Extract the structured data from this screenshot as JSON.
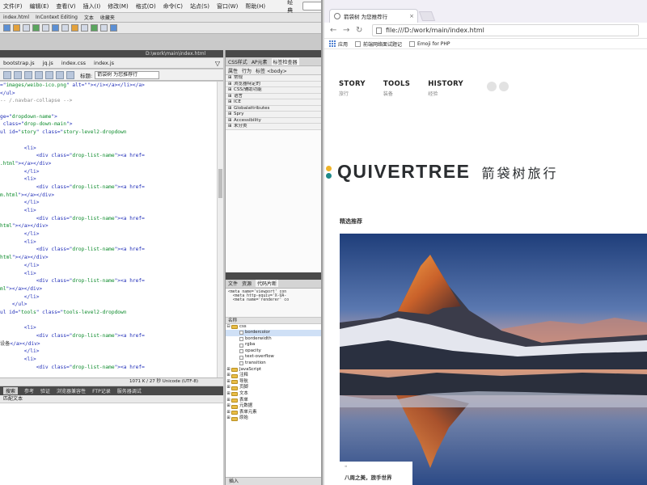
{
  "ide": {
    "menu": [
      "文件(F)",
      "编辑(E)",
      "查看(V)",
      "插入(I)",
      "修改(M)",
      "格式(O)",
      "命令(C)",
      "站点(S)",
      "窗口(W)",
      "帮助(H)"
    ],
    "search_mode": "经典",
    "window_buttons": [
      "–",
      "□",
      "✕"
    ],
    "doc_tabs": [
      "index.html",
      "InContext Editing",
      "文本",
      "收藏夹"
    ],
    "path": "D:\\work\\main\\index.html",
    "file_tabs": [
      "bootstrap.js",
      "jq.js",
      "index.css",
      "index.js"
    ],
    "filter_icon": "funnel-icon",
    "title_label": "标题:",
    "title_value": "箭袋树 为您推荐行",
    "code_lines": [
      [
        [
          "attr",
          "=\""
        ],
        [
          "str",
          "images/weibo-ico.png"
        ],
        [
          "attr",
          "\" alt=\"\">"
        ],
        [
          "tag",
          "</i></a></li></a>"
        ]
      ],
      [
        [
          "tag",
          "</ul>"
        ]
      ],
      [
        [
          "cmt",
          "-- /.navbar-collapse -->"
        ]
      ],
      [
        [
          "txt",
          ""
        ]
      ],
      [
        [
          "attr",
          "ge=\""
        ],
        [
          "str",
          "dropdown-name"
        ],
        [
          "attr",
          "\">"
        ]
      ],
      [
        [
          "tag",
          " class=\""
        ],
        [
          "str",
          "drop-down-main"
        ],
        [
          "tag",
          "\">"
        ]
      ],
      [
        [
          "tag",
          "ul id=\""
        ],
        [
          "str",
          "story"
        ],
        [
          "tag",
          "\" class=\""
        ],
        [
          "str",
          "story-level2-dropdown"
        ]
      ],
      [
        [
          "txt",
          ""
        ]
      ],
      [
        [
          "tag",
          "        <li>"
        ]
      ],
      [
        [
          "tag",
          "            <div class=\""
        ],
        [
          "str",
          "drop-list-name"
        ],
        [
          "tag",
          "\"><a href="
        ]
      ],
      [
        [
          "str",
          ".html"
        ],
        [
          "tag",
          "\">"
        ],
        [
          "txt",
          "\u0007"
        ],
        [
          "tag",
          "</a></div>"
        ]
      ],
      [
        [
          "tag",
          "        </li>"
        ]
      ],
      [
        [
          "tag",
          "        <li>"
        ]
      ],
      [
        [
          "tag",
          "            <div class=\""
        ],
        [
          "str",
          "drop-list-name"
        ],
        [
          "tag",
          "\"><a href="
        ]
      ],
      [
        [
          "str",
          "m.html"
        ],
        [
          "tag",
          "\">"
        ],
        [
          "txt",
          "\u0007"
        ],
        [
          "tag",
          "</a></div>"
        ]
      ],
      [
        [
          "tag",
          "        </li>"
        ]
      ],
      [
        [
          "tag",
          "        <li>"
        ]
      ],
      [
        [
          "tag",
          "            <div class=\""
        ],
        [
          "str",
          "drop-list-name"
        ],
        [
          "tag",
          "\"><a href="
        ]
      ],
      [
        [
          "str",
          "html"
        ],
        [
          "tag",
          "\">"
        ],
        [
          "txt",
          "\u0007"
        ],
        [
          "tag",
          "</a></div>"
        ]
      ],
      [
        [
          "tag",
          "        </li>"
        ]
      ],
      [
        [
          "tag",
          "        <li>"
        ]
      ],
      [
        [
          "tag",
          "            <div class=\""
        ],
        [
          "str",
          "drop-list-name"
        ],
        [
          "tag",
          "\"><a href="
        ]
      ],
      [
        [
          "str",
          "html"
        ],
        [
          "tag",
          "\">"
        ],
        [
          "txt",
          "\u0007"
        ],
        [
          "tag",
          "</a></div>"
        ]
      ],
      [
        [
          "tag",
          "        </li>"
        ]
      ],
      [
        [
          "tag",
          "        <li>"
        ]
      ],
      [
        [
          "tag",
          "            <div class=\""
        ],
        [
          "str",
          "drop-list-name"
        ],
        [
          "tag",
          "\"><a href="
        ]
      ],
      [
        [
          "str",
          "ml"
        ],
        [
          "tag",
          "\">"
        ],
        [
          "txt",
          "\u0007"
        ],
        [
          "tag",
          "</a></div>"
        ]
      ],
      [
        [
          "tag",
          "        </li>"
        ]
      ],
      [
        [
          "tag",
          "    </ul>"
        ]
      ],
      [
        [
          "tag",
          "ul id=\""
        ],
        [
          "str",
          "tools"
        ],
        [
          "tag",
          "\" class=\""
        ],
        [
          "str",
          "tools-level2-dropdown"
        ]
      ],
      [
        [
          "txt",
          ""
        ]
      ],
      [
        [
          "tag",
          "        <li>"
        ]
      ],
      [
        [
          "tag",
          "            <div class=\""
        ],
        [
          "str",
          "drop-list-name"
        ],
        [
          "tag",
          "\"><a href="
        ]
      ],
      [
        [
          "txt",
          "设备"
        ],
        [
          "tag",
          "</a></div>"
        ]
      ],
      [
        [
          "tag",
          "        </li>"
        ]
      ],
      [
        [
          "tag",
          "        <li>"
        ]
      ],
      [
        [
          "tag",
          "            <div class=\""
        ],
        [
          "str",
          "drop-list-name"
        ],
        [
          "tag",
          "\"><a href="
        ]
      ]
    ],
    "status": "1071 K / 27 秒 Unicode (UTF-8)",
    "bottom_tabs": [
      "搜索",
      "参考",
      "验证",
      "浏览器兼容性",
      "FTP记录",
      "服务器调试"
    ],
    "bottom_sub": "匹配文本",
    "rp_tabs": [
      "CSS样式",
      "AP元素",
      "标签检查器"
    ],
    "rp_sub": [
      "属性",
      "行为",
      "标签 <body>"
    ],
    "css_categories": [
      "常规",
      "浏览器特定的",
      "CSS/辅助功能",
      "语言",
      "ICE",
      "Globalattributes",
      "Spry",
      "Accessibility",
      "未分类"
    ],
    "rp2_tabs": [
      "文件",
      "资源",
      "代码片断"
    ],
    "snippet": "<meta name='viewport' con\n  <meta http-equiv='X-UA-\n  <meta name='renderer' co",
    "tree_head": "名称",
    "tree_root": "css",
    "tree_items": [
      {
        "label": "css",
        "kind": "folder",
        "exp": "⊟"
      },
      {
        "label": "bordercolor",
        "kind": "file",
        "exp": ""
      },
      {
        "label": "borderwidth",
        "kind": "file",
        "exp": ""
      },
      {
        "label": "rgba",
        "kind": "file",
        "exp": ""
      },
      {
        "label": "opacity",
        "kind": "file",
        "exp": ""
      },
      {
        "label": "text-overflow",
        "kind": "file",
        "exp": ""
      },
      {
        "label": "transition",
        "kind": "file",
        "exp": ""
      },
      {
        "label": "JavaScript",
        "kind": "folder",
        "exp": "⊞"
      },
      {
        "label": "注释",
        "kind": "folder",
        "exp": "⊞"
      },
      {
        "label": "导航",
        "kind": "folder",
        "exp": "⊞"
      },
      {
        "label": "页脚",
        "kind": "folder",
        "exp": "⊞"
      },
      {
        "label": "文本",
        "kind": "folder",
        "exp": "⊞"
      },
      {
        "label": "表单",
        "kind": "folder",
        "exp": "⊞"
      },
      {
        "label": "元数据",
        "kind": "folder",
        "exp": "⊞"
      },
      {
        "label": "表单元素",
        "kind": "folder",
        "exp": "⊞"
      },
      {
        "label": "原始",
        "kind": "folder",
        "exp": "⊞"
      }
    ],
    "rp_footer": "插入"
  },
  "browser": {
    "tab_title": "箭袋树 为您推荐行",
    "tab_close": "×",
    "url": "file:///D:/work/main/index.html",
    "nav": [
      "←",
      "→",
      "↻"
    ],
    "bookmarks": [
      {
        "label": "应用",
        "icon": "apps-grid-icon"
      },
      {
        "label": "前端网络面试题记",
        "icon": "page-icon"
      },
      {
        "label": "Emoji for PHP",
        "icon": "page-icon"
      }
    ]
  },
  "site": {
    "nav": [
      {
        "en": "STORY",
        "cn": "旅行"
      },
      {
        "en": "TOOLS",
        "cn": "装备"
      },
      {
        "en": "HISTORY",
        "cn": "经验"
      }
    ],
    "logo": "QUIVERTREE",
    "logo_cn": "箭袋树旅行",
    "logo_dot_colors": [
      "#f0b429",
      "#1f8a8a",
      "#2a2d30"
    ],
    "section_title": "精选推荐",
    "caption_quote": "❝",
    "caption_text": "八周之美，旅手世界"
  }
}
